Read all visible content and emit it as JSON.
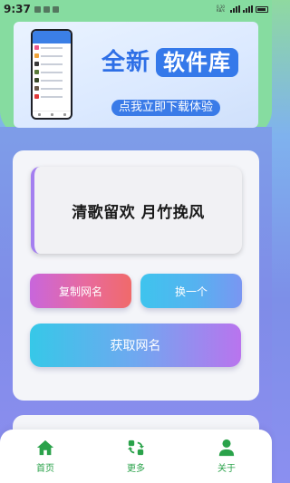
{
  "status_bar": {
    "time": "9:37",
    "net_speed": "0.10 KB/s"
  },
  "banner": {
    "title": "全新",
    "title_highlight": "软件库",
    "subtitle": "点我立即下载体验"
  },
  "result": {
    "name": "清歌留欢 月竹挽风"
  },
  "buttons": {
    "copy": "复制网名",
    "switch": "换一个",
    "get": "获取网名"
  },
  "nav": {
    "items": [
      {
        "label": "首页",
        "icon": "home-icon"
      },
      {
        "label": "更多",
        "icon": "refresh-icon"
      },
      {
        "label": "关于",
        "icon": "user-icon"
      }
    ]
  },
  "colors": {
    "accent_green": "#2aa24a",
    "banner_blue": "#3579ea"
  }
}
